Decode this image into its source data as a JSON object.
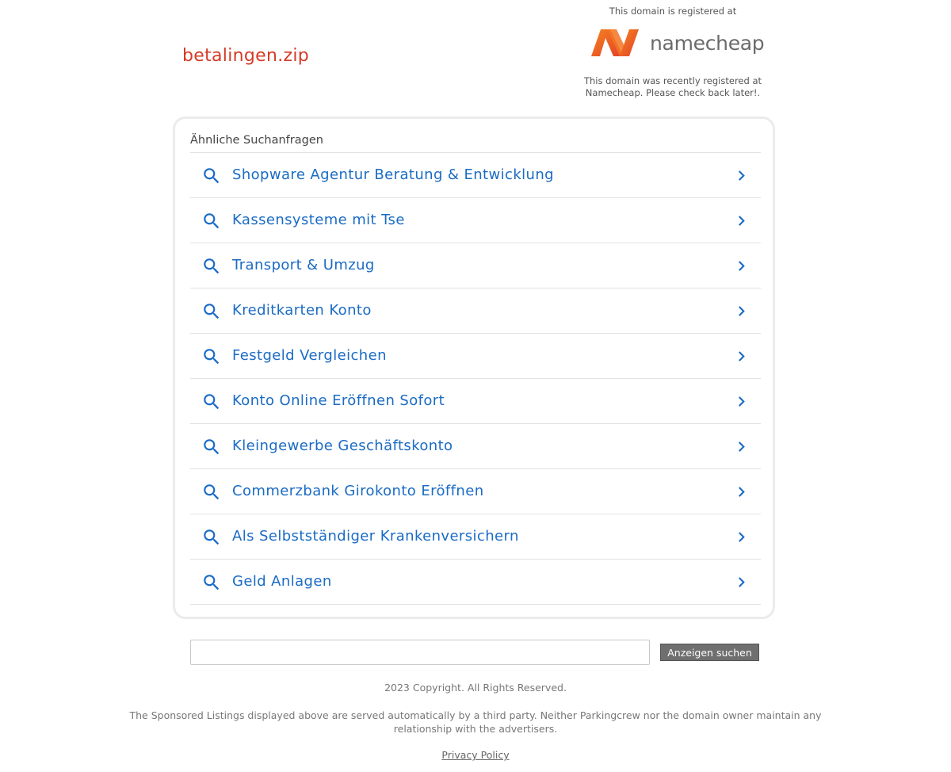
{
  "header": {
    "domain": "betalingen.zip",
    "registrar": {
      "top_text": "This domain is registered at",
      "logo_text": "namecheap",
      "bottom_line1": "This domain was recently registered at",
      "bottom_line2": "Namecheap. Please check back later!."
    }
  },
  "panel": {
    "heading": "Ähnliche Suchanfragen",
    "results": [
      {
        "label": "Shopware Agentur Beratung & Entwicklung"
      },
      {
        "label": "Kassensysteme mit Tse"
      },
      {
        "label": "Transport & Umzug"
      },
      {
        "label": "Kreditkarten Konto"
      },
      {
        "label": "Festgeld Vergleichen"
      },
      {
        "label": "Konto Online Eröffnen Sofort"
      },
      {
        "label": "Kleingewerbe Geschäftskonto"
      },
      {
        "label": "Commerzbank Girokonto Eröffnen"
      },
      {
        "label": "Als Selbstständiger Krankenversichern"
      },
      {
        "label": "Geld Anlagen"
      }
    ],
    "result_icon": "search-icon",
    "result_arrow_icon": "chevron-right-icon"
  },
  "search": {
    "value": "",
    "button_label": "Anzeigen suchen"
  },
  "footer": {
    "copyright": "2023 Copyright. All Rights Reserved.",
    "disclaimer": "The Sponsored Listings displayed above are served automatically by a third party. Neither Parkingcrew nor the domain owner maintain any relationship with the advertisers.",
    "privacy_label": "Privacy Policy"
  },
  "colors": {
    "domain_title": "#d63a26",
    "link": "#1a6bc4",
    "namecheap_orange": "#f15a22"
  }
}
